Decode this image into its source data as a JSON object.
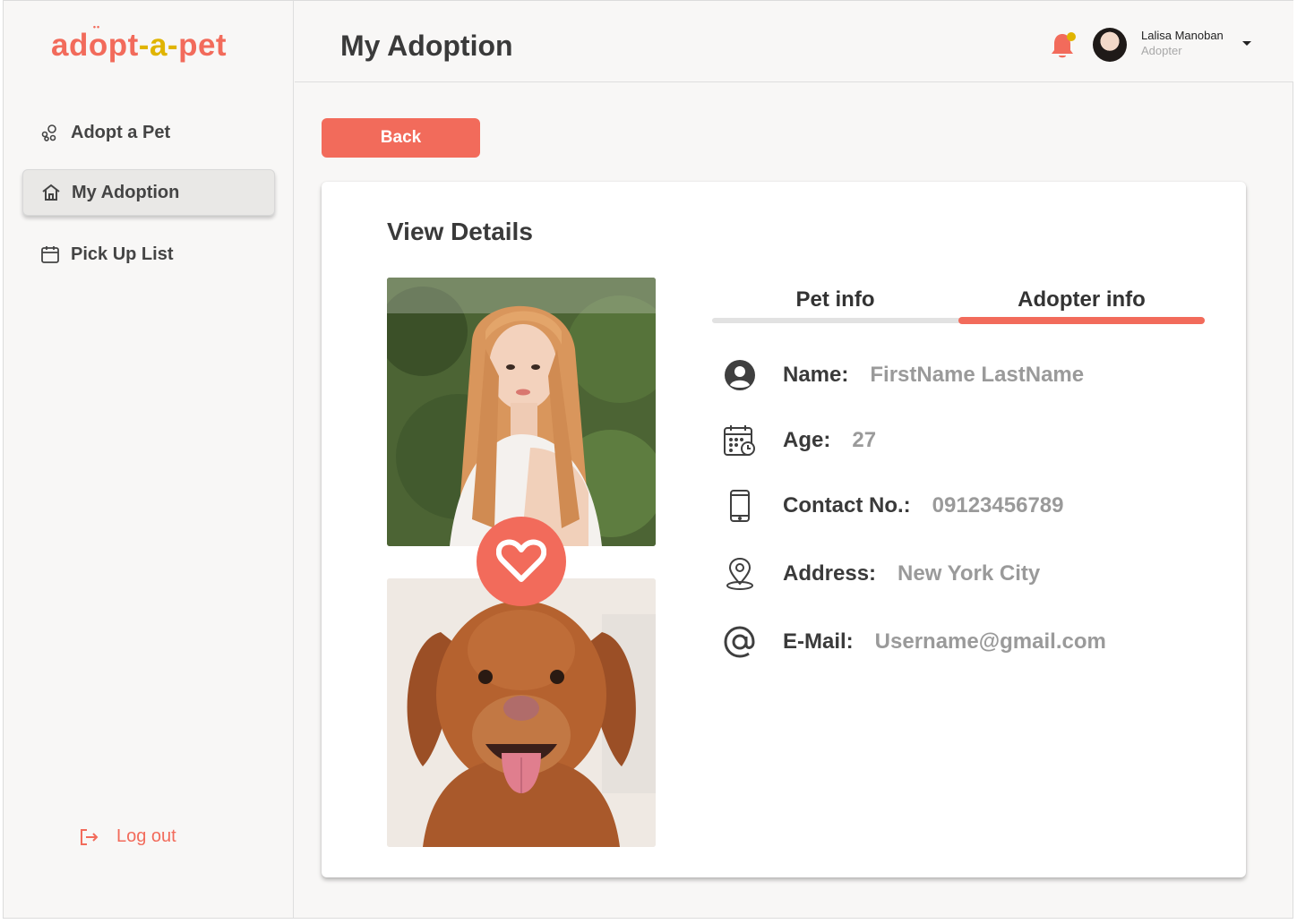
{
  "brand": {
    "logo_part1": "ad",
    "logo_part2": "o",
    "logo_part3": "pt",
    "logo_part4": "-a-",
    "logo_part5": "pet",
    "colors": {
      "primary": "#f26b5b",
      "accent": "#e0b400"
    }
  },
  "sidebar": {
    "items": [
      {
        "label": "Adopt a Pet",
        "icon": "paw-circles-icon"
      },
      {
        "label": "My Adoption",
        "icon": "home-icon",
        "active": true
      },
      {
        "label": "Pick Up List",
        "icon": "calendar-icon"
      }
    ],
    "logout_label": "Log out"
  },
  "header": {
    "title": "My Adoption",
    "user": {
      "name": "Lalisa Manoban",
      "role": "Adopter"
    }
  },
  "main": {
    "back_label": "Back",
    "card_title": "View Details",
    "tabs": [
      {
        "label": "Pet info",
        "active": false
      },
      {
        "label": "Adopter info",
        "active": true
      }
    ],
    "fields": [
      {
        "label": "Name:",
        "value": "FirstName LastName",
        "icon": "user-circle-icon"
      },
      {
        "label": "Age:",
        "value": "27",
        "icon": "calendar-clock-icon"
      },
      {
        "label": "Contact No.:",
        "value": "09123456789",
        "icon": "phone-icon"
      },
      {
        "label": "Address:",
        "value": "New York City",
        "icon": "location-pin-icon"
      },
      {
        "label": "E-Mail:",
        "value": "Username@gmail.com",
        "icon": "at-sign-icon"
      }
    ]
  }
}
